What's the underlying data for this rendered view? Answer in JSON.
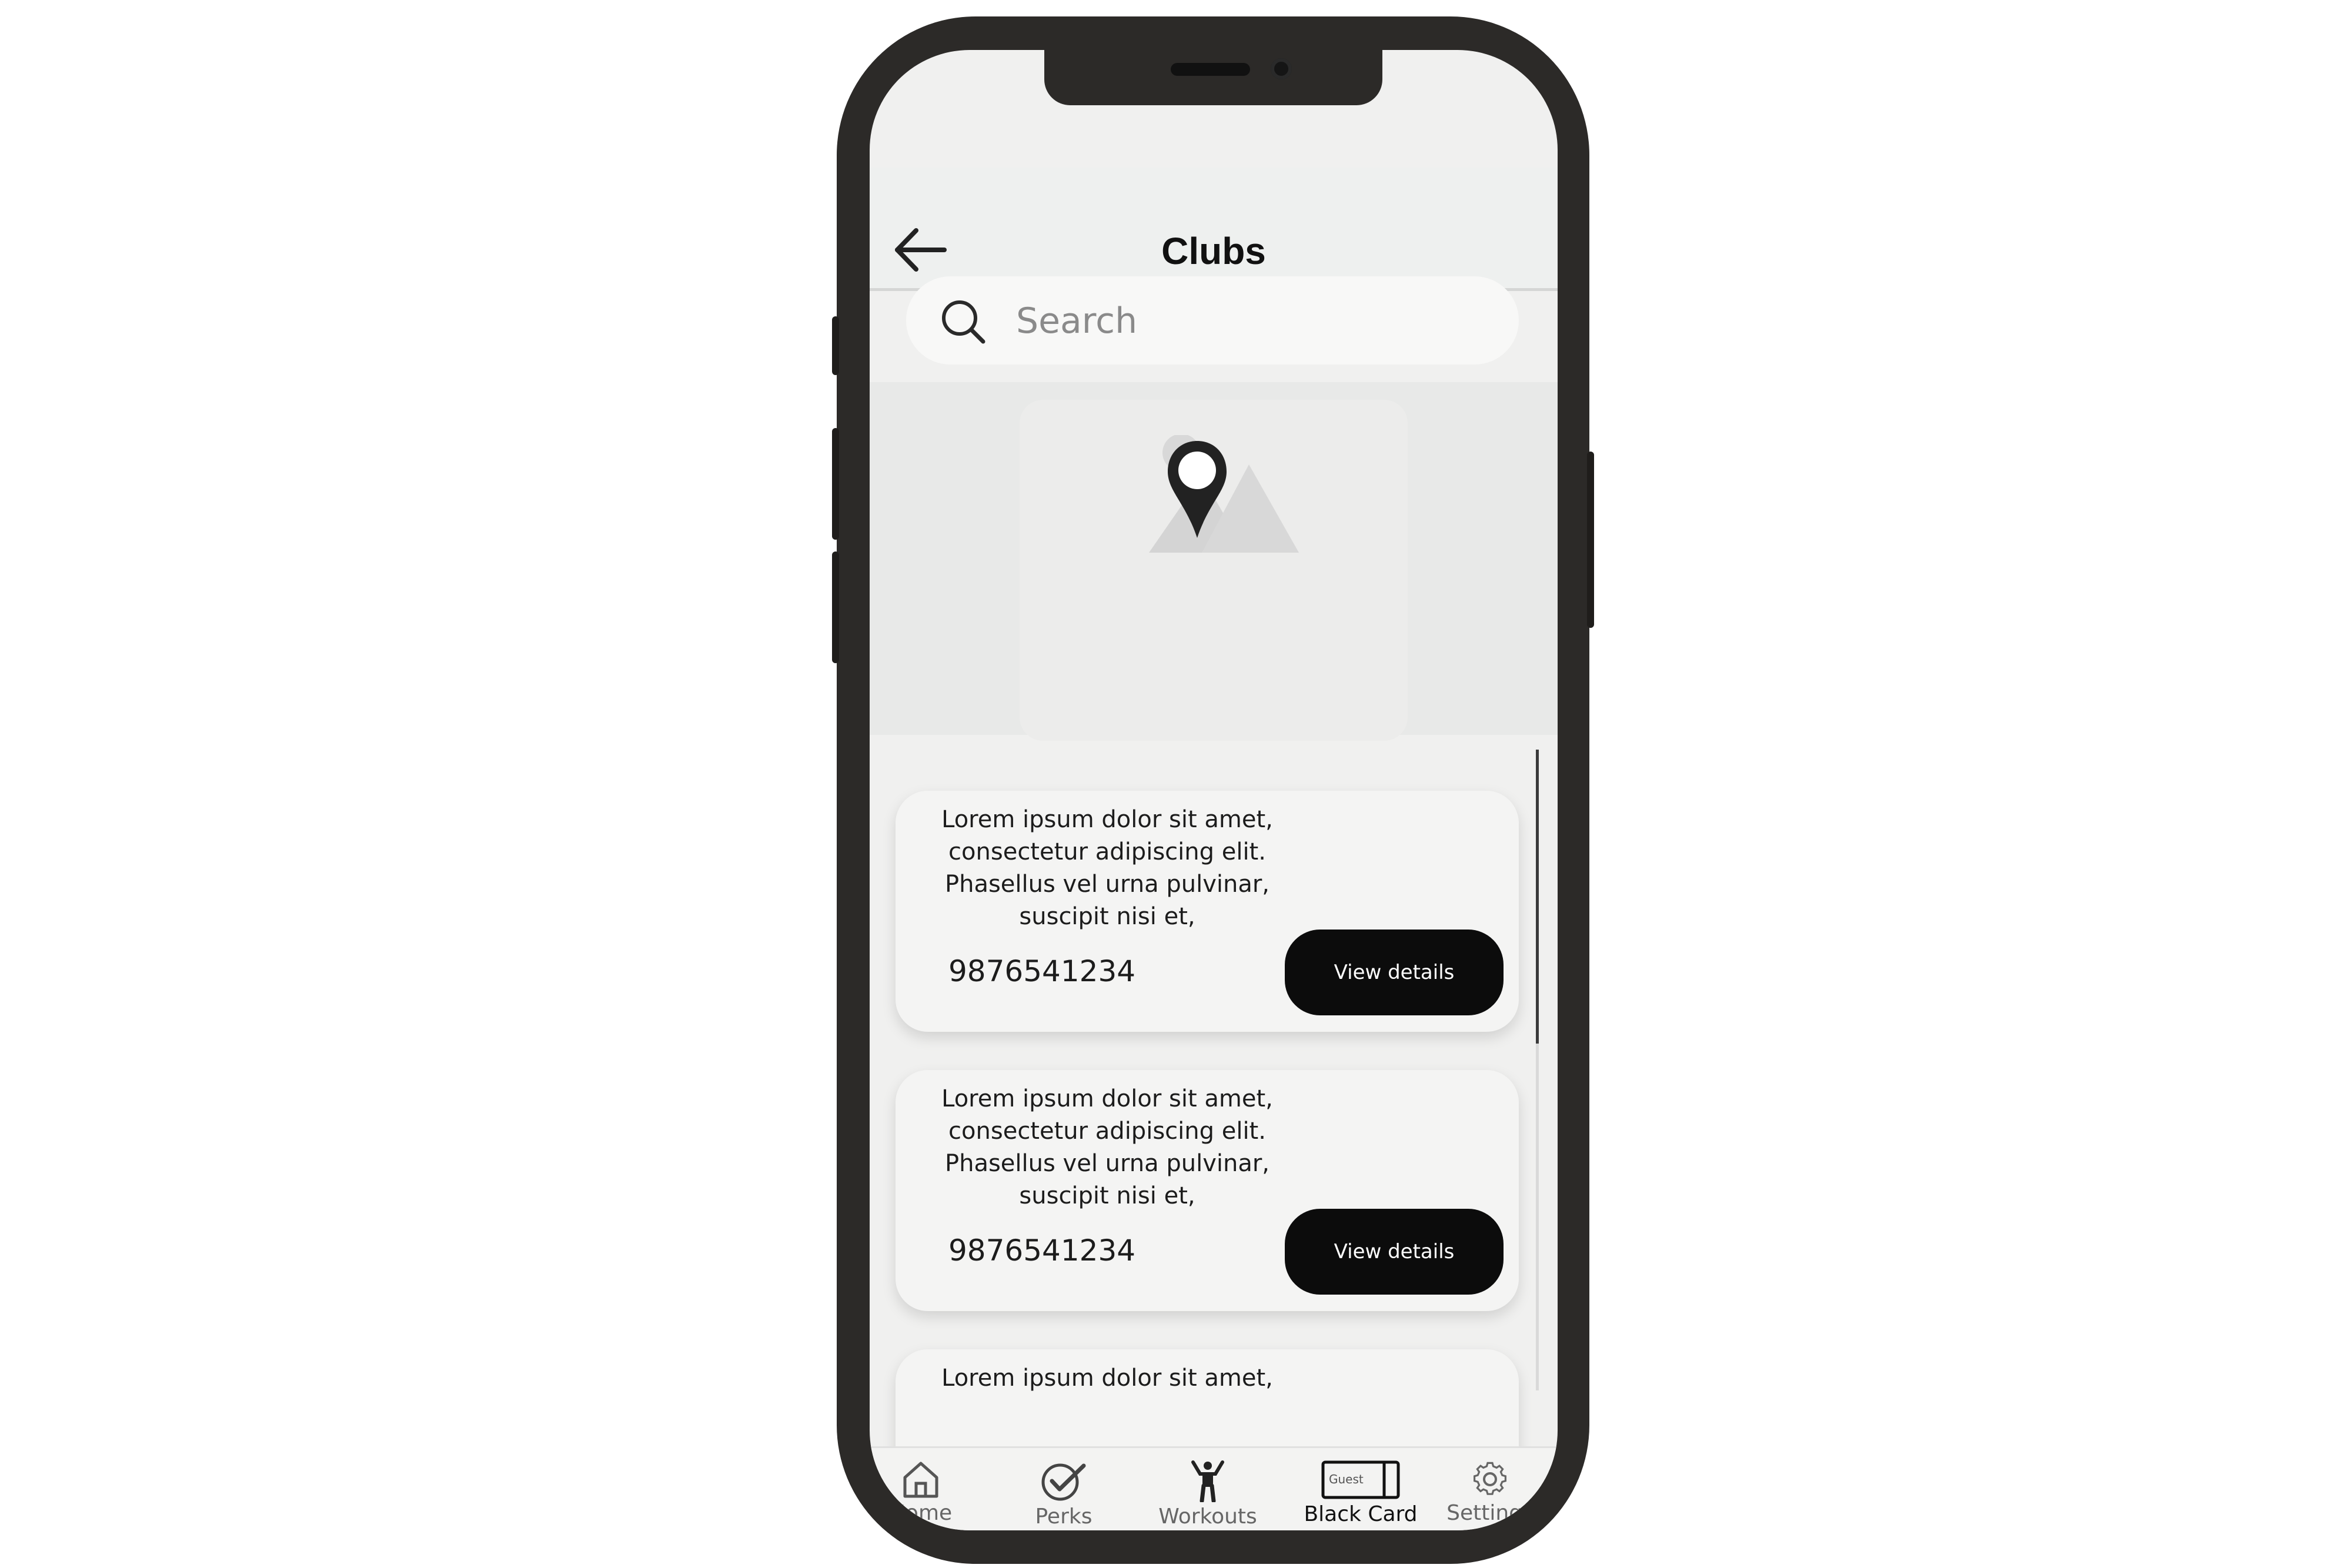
{
  "header": {
    "title": "Clubs"
  },
  "search": {
    "placeholder": "Search"
  },
  "clubs": [
    {
      "description": "Lorem ipsum dolor sit amet, consectetur adipiscing elit. Phasellus vel urna pulvinar, suscipit nisi et,",
      "phone": "9876541234",
      "button_label": "View details"
    },
    {
      "description": "Lorem ipsum dolor sit amet, consectetur adipiscing elit. Phasellus vel urna pulvinar, suscipit nisi et,",
      "phone": "9876541234",
      "button_label": "View details"
    },
    {
      "description": "Lorem ipsum dolor sit amet,"
    }
  ],
  "tabs": [
    {
      "label": "Home",
      "icon": "home-icon"
    },
    {
      "label": "Perks",
      "icon": "check-circle-icon"
    },
    {
      "label": "Workouts",
      "icon": "person-workout-icon"
    },
    {
      "label": "Black Card",
      "icon": "card-icon",
      "badge": "Guest",
      "active": true
    },
    {
      "label": "Settings",
      "icon": "gear-icon"
    }
  ]
}
